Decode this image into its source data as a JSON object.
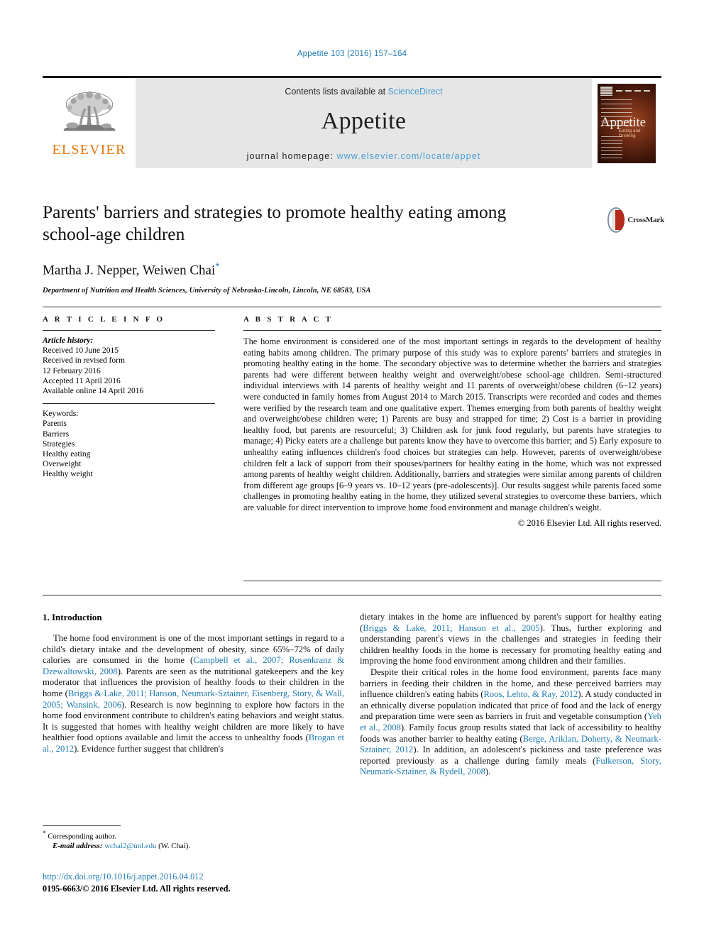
{
  "running_head": "Appetite 103 (2016) 157–164",
  "masthead": {
    "publisher_name": "ELSEVIER",
    "contents_prefix": "Contents lists available at ",
    "contents_link": "ScienceDirect",
    "journal_name": "Appetite",
    "homepage_prefix": "journal homepage: ",
    "homepage_url": "www.elsevier.com/locate/appet",
    "cover_title": "Appetite",
    "cover_subtitle": "Eating and Drinking"
  },
  "title_block": {
    "title": "Parents' barriers and strategies to promote healthy eating among school-age children",
    "authors": "Martha J. Nepper, Weiwen Chai",
    "corresponding_marker": "*",
    "affiliation": "Department of Nutrition and Health Sciences, University of Nebraska-Lincoln, Lincoln, NE 68583, USA",
    "crossmark_label": "CrossMark"
  },
  "article_info": {
    "heading": "A R T I C L E   I N F O",
    "history_label": "Article history:",
    "history": [
      "Received 10 June 2015",
      "Received in revised form",
      "12 February 2016",
      "Accepted 11 April 2016",
      "Available online 14 April 2016"
    ],
    "keywords_label": "Keywords:",
    "keywords": [
      "Parents",
      "Barriers",
      "Strategies",
      "Healthy eating",
      "Overweight",
      "Healthy weight"
    ]
  },
  "abstract": {
    "heading": "A B S T R A C T",
    "text": "The home environment is considered one of the most important settings in regards to the development of healthy eating habits among children. The primary purpose of this study was to explore parents' barriers and strategies in promoting healthy eating in the home. The secondary objective was to determine whether the barriers and strategies parents had were different between healthy weight and overweight/obese school-age children. Semi-structured individual interviews with 14 parents of healthy weight and 11 parents of overweight/obese children (6–12 years) were conducted in family homes from August 2014 to March 2015. Transcripts were recorded and codes and themes were verified by the research team and one qualitative expert. Themes emerging from both parents of healthy weight and overweight/obese children were; 1) Parents are busy and strapped for time; 2) Cost is a barrier in providing healthy food, but parents are resourceful; 3) Children ask for junk food regularly, but parents have strategies to manage; 4) Picky eaters are a challenge but parents know they have to overcome this barrier; and 5) Early exposure to unhealthy eating influences children's food choices but strategies can help. However, parents of overweight/obese children felt a lack of support from their spouses/partners for healthy eating in the home, which was not expressed among parents of healthy weight children. Additionally, barriers and strategies were similar among parents of children from different age groups [6–9 years vs. 10–12 years (pre-adolescents)]. Our results suggest while parents faced some challenges in promoting healthy eating in the home, they utilized several strategies to overcome these barriers, which are valuable for direct intervention to improve home food environment and manage children's weight.",
    "copyright": "© 2016 Elsevier Ltd. All rights reserved."
  },
  "introduction": {
    "heading": "1. Introduction",
    "left_paragraph_1": {
      "part1": "The home food environment is one of the most important settings in regard to a child's dietary intake and the development of obesity, since 65%–72% of daily calories are consumed in the home (",
      "cite1": "Campbell et al., 2007; Rosenkranz & Dzewaltowski, 2008",
      "part2": "). Parents are seen as the nutritional gatekeepers and the key moderator that influences the provision of healthy foods to their children in the home (",
      "cite2": "Briggs & Lake, 2011; Hanson, Neumark-Sztainer, Eisenberg, Story, & Wall, 2005; Wansink, 2006",
      "part3": "). Research is now beginning to explore how factors in the home food environment contribute to children's eating behaviors and weight status. It is suggested that homes with healthy weight children are more likely to have healthier food options available and limit the access to unhealthy foods (",
      "cite3": "Brogan et al., 2012",
      "part4": "). Evidence further suggest that children's"
    },
    "right_paragraph_1": {
      "part1": "dietary intakes in the home are influenced by parent's support for healthy eating (",
      "cite1": "Briggs & Lake, 2011; Hanson et al., 2005",
      "part2": "). Thus, further exploring and understanding parent's views in the challenges and strategies in feeding their children healthy foods in the home is necessary for promoting healthy eating and improving the home food environment among children and their families."
    },
    "right_paragraph_2": {
      "part1": "Despite their critical roles in the home food environment, parents face many barriers in feeding their children in the home, and these perceived barriers may influence children's eating habits (",
      "cite1": "Roos, Lehto, & Ray, 2012",
      "part2": "). A study conducted in an ethnically diverse population indicated that price of food and the lack of energy and preparation time were seen as barriers in fruit and vegetable consumption (",
      "cite2": "Yeh et al., 2008",
      "part3": "). Family focus group results stated that lack of accessibility to healthy foods was another barrier to healthy eating (",
      "cite3": "Berge, Ariklan, Doherty, & Neumark-Sztainer, 2012",
      "part4": "). In addition, an adolescent's pickiness and taste preference was reported previously as a challenge during family meals (",
      "cite4": "Fulkerson, Story, Neumark-Sztainer, & Rydell, 2008",
      "part5": ")."
    }
  },
  "footnote": {
    "marker": "*",
    "corresponding": "Corresponding author.",
    "email_label": "E-mail address:",
    "email": "wchai2@unl.edu",
    "email_owner": "(W. Chai)."
  },
  "footer": {
    "doi": "http://dx.doi.org/10.1016/j.appet.2016.04.012",
    "issn": "0195-6663/© 2016 Elsevier Ltd. All rights reserved."
  },
  "colors": {
    "link_blue": "#1f7ab0",
    "elsevier_orange": "#e8770d",
    "banner_gray": "#e6e6e6"
  }
}
